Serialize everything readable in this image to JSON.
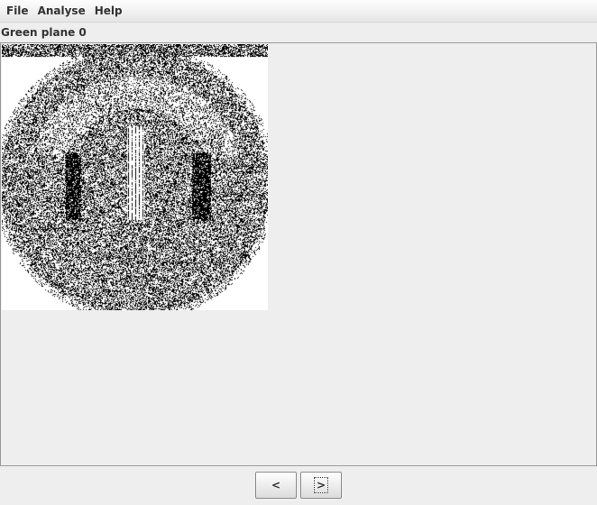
{
  "menubar": {
    "items": [
      "File",
      "Analyse",
      "Help"
    ]
  },
  "panel": {
    "title": "Green plane 0"
  },
  "navigation": {
    "prev_label": "<",
    "next_label": ">"
  },
  "image": {
    "description_icon": "bit-plane-image"
  }
}
